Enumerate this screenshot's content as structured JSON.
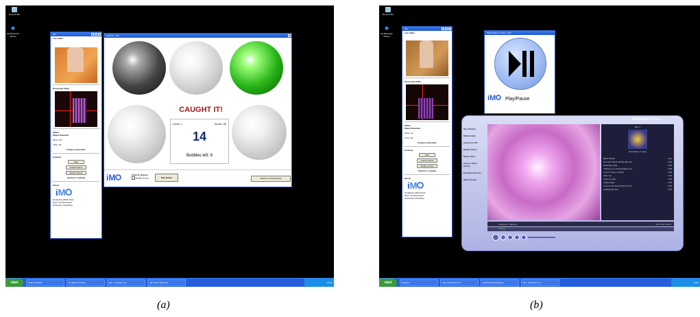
{
  "desktop": {
    "recycle_bin": "Recycle Bin",
    "bluetooth_mouse": "My Bluetooth Mouse"
  },
  "panel": {
    "title": "iMo",
    "live_video": "Live Video",
    "processed_video": "Processed Video",
    "status_heading": "Status",
    "object_detected": "Object Detected",
    "xpos_label": "XPos:",
    "ypos_label": "YPos:",
    "camera_status": "Camera connected.",
    "controls_heading": "Controls",
    "stop_button": "Stop",
    "launch_game_button": "Launch Game",
    "media_control_button": "Media Control",
    "system_status": "System is running",
    "about_heading": "About",
    "about_line1": "Created by Mark Poole",
    "about_line2": "Dept. Of Cybernetics",
    "about_line3": "University of Reading"
  },
  "screen_a": {
    "xpos": "127",
    "ypos": "46",
    "game_window_title": "Catch It! - iMo",
    "caught_text": "CAUGHT IT!",
    "level_label": "Level: 1",
    "score_label": "Score: 30",
    "big_number": "14",
    "bubbles_left": "Bubbles left: 8",
    "options_heading": "Catch It! Options",
    "enable_sound": "Enable Sound",
    "play_game_button": "Play Game!",
    "switch_mode_button": "Switch to Testing Mode",
    "taskbar": {
      "start": "start",
      "tasks": [
        "Project Diff-Edi",
        "My Bluetooth Mou",
        "iMo - Interaction sy",
        "Jasc Paint Shop Pro"
      ],
      "clock": "12:00"
    }
  },
  "screen_b": {
    "xpos": "76",
    "ypos": "93",
    "media_control_title": "Media Player Control - iMo",
    "play_pause_label": "Play/Pause",
    "wmp_title": "Permission to La...",
    "wmp_nav": [
      "Now Playing",
      "Media Guide",
      "Copy from CD",
      "Media Library",
      "Radio Tuner",
      "Copy to CD or Device",
      "Premium Services",
      "Skin Chooser"
    ],
    "album_title": "Permission to Land",
    "disc_label": "Disc 1",
    "tracks": [
      {
        "name": "Black Shuck",
        "time": "3:21"
      },
      {
        "name": "Get Your Hands Off My Woman",
        "time": "2:46"
      },
      {
        "name": "Growing on Me",
        "time": "3:28"
      },
      {
        "name": "I Believe in a Thing Called Love",
        "time": "3:38"
      },
      {
        "name": "Love Is Only a Feeling",
        "time": "4:20"
      },
      {
        "name": "Givin' Up",
        "time": "3:34"
      },
      {
        "name": "Stuck in a Rut",
        "time": "3:18"
      },
      {
        "name": "Friday Night",
        "time": "2:55"
      },
      {
        "name": "Love on the Rocks With No Ice",
        "time": "5:56"
      },
      {
        "name": "Holding My Own",
        "time": "4:58"
      }
    ],
    "total_time": "Total Time: 39:10",
    "visualization": "Ambience : Random",
    "playing_status": "Playing",
    "taskbar": {
      "start": "start",
      "tasks": [
        "Project 2",
        "Jasc Paint Shop Pro",
        "Windows Media Player",
        "iMo - Interaction sy"
      ],
      "clock": "12:00"
    }
  },
  "captions": {
    "a": "(a)",
    "b": "(b)"
  }
}
